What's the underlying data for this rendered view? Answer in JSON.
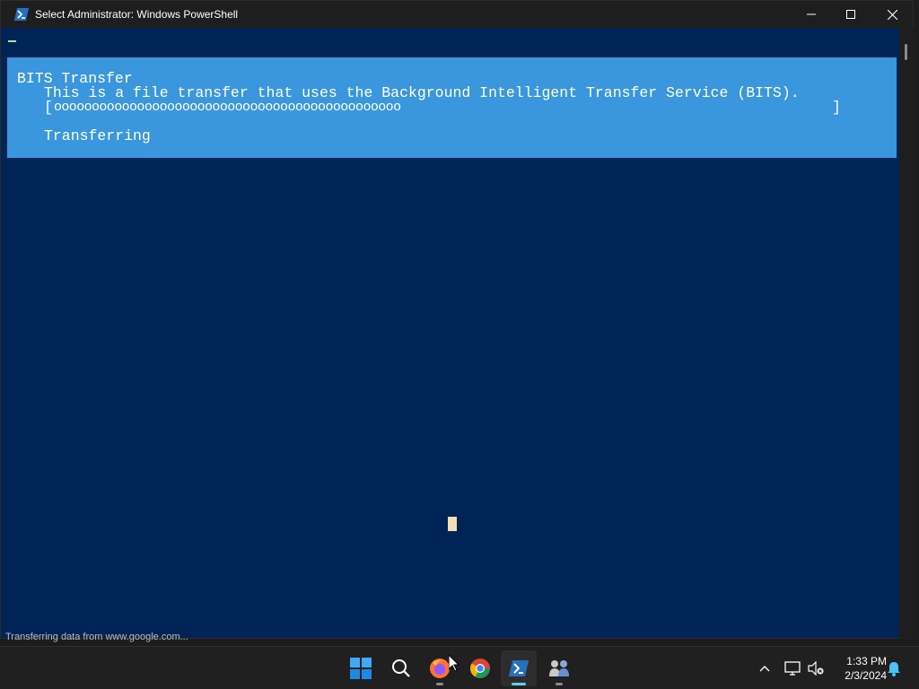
{
  "window": {
    "title": "Select Administrator: Windows PowerShell",
    "icon": "powershell-icon",
    "controls": [
      "minimize-icon",
      "maximize-icon",
      "close-icon"
    ]
  },
  "console": {
    "background": "#012456",
    "progress": {
      "background": "#3a96dd",
      "activity": "BITS Transfer",
      "description": "This is a file transfer that uses the Background Intelligent Transfer Service (BITS).",
      "bar_open": "[",
      "bar_fill": "oooooooooooooooooooooooooooooooooooooooooooooo",
      "bar_close": "]",
      "status": "Transferring"
    }
  },
  "background_status": "Transferring data from www.google.com...",
  "taskbar": {
    "apps": [
      "start-icon",
      "search-icon",
      "firefox-icon",
      "chrome-icon",
      "powershell-icon",
      "teams-icon"
    ],
    "clock": {
      "time": "1:33 PM",
      "date": "2/3/2024"
    },
    "tray_icons": [
      "chevron-up-icon",
      "network-icon",
      "volume-muted-icon",
      "notification-bell-icon"
    ]
  }
}
